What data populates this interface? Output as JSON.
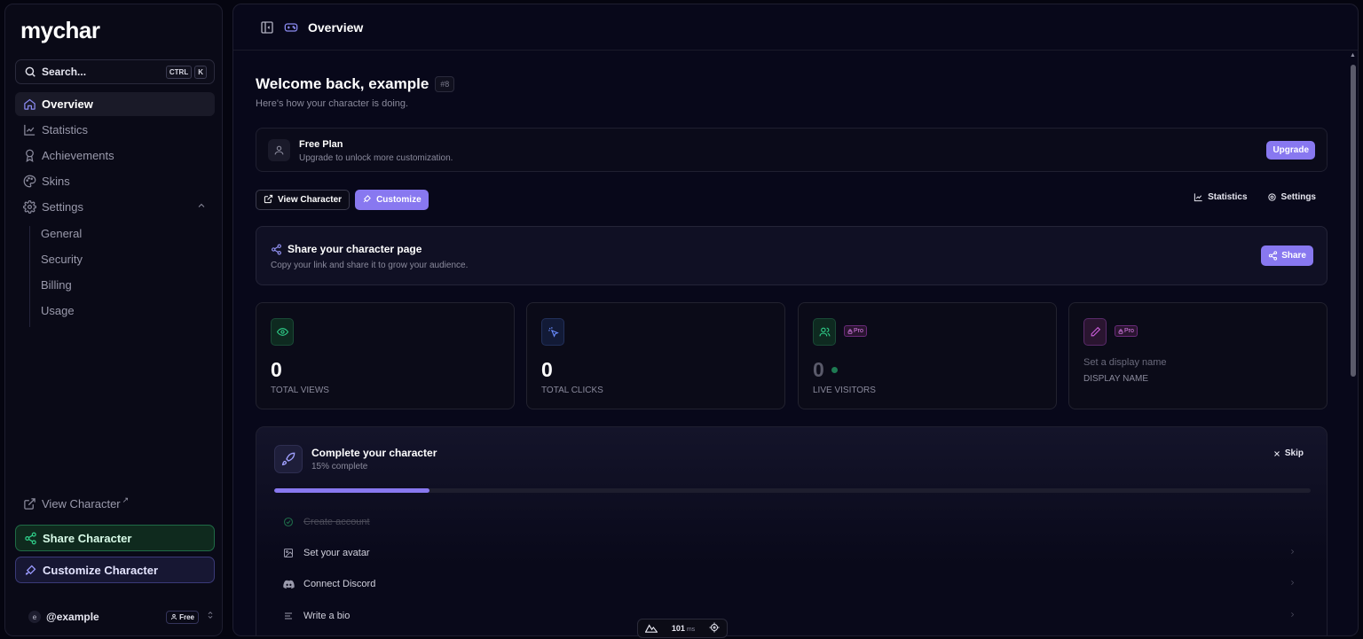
{
  "app": {
    "logo": "mychar"
  },
  "sidebar": {
    "search": {
      "label": "Search...",
      "kbd1": "CTRL",
      "kbd2": "K"
    },
    "items": [
      {
        "label": "Overview",
        "icon": "home-icon",
        "active": true
      },
      {
        "label": "Statistics",
        "icon": "chart-line-icon"
      },
      {
        "label": "Achievements",
        "icon": "award-icon"
      },
      {
        "label": "Skins",
        "icon": "palette-icon"
      },
      {
        "label": "Settings",
        "icon": "gear-icon",
        "expanded": true
      }
    ],
    "settings_sub": [
      "General",
      "Security",
      "Billing",
      "Usage"
    ],
    "view_character": "View Character",
    "share_character": "Share Character",
    "customize_character": "Customize Character",
    "user": {
      "avatar_letter": "e",
      "name": "@example",
      "plan_badge": "Free"
    }
  },
  "topbar": {
    "title": "Overview"
  },
  "welcome": {
    "title": "Welcome back, example",
    "tag": "#8",
    "subtitle": "Here's how your character is doing."
  },
  "plan": {
    "title": "Free Plan",
    "subtitle": "Upgrade to unlock more customization.",
    "upgrade_label": "Upgrade"
  },
  "actions": {
    "view_character": "View Character",
    "customize": "Customize",
    "statistics": "Statistics",
    "settings": "Settings"
  },
  "share": {
    "title": "Share your character page",
    "subtitle": "Copy your link and share it to grow your audience.",
    "button": "Share"
  },
  "stats": [
    {
      "value": "0",
      "label": "TOTAL VIEWS",
      "icon": "eye-icon",
      "color": "#2fd08a"
    },
    {
      "value": "0",
      "label": "TOTAL CLICKS",
      "icon": "cursor-click-icon",
      "color": "#6a8cff"
    },
    {
      "value": "0",
      "label": "LIVE VISITORS",
      "icon": "users-icon",
      "color": "#2fd08a",
      "pro": "Pro"
    },
    {
      "placeholder": "Set a display name",
      "label": "DISPLAY NAME",
      "icon": "pencil-icon",
      "color": "#d060e0",
      "pro": "Pro"
    }
  ],
  "onboarding": {
    "title": "Complete your character",
    "progress_text": "15% complete",
    "progress": 0.15,
    "skip_label": "Skip",
    "tasks": [
      {
        "label": "Create account",
        "done": true,
        "icon": "check-circle-icon"
      },
      {
        "label": "Set your avatar",
        "done": false,
        "icon": "image-icon"
      },
      {
        "label": "Connect Discord",
        "done": false,
        "icon": "discord-icon"
      },
      {
        "label": "Write a bio",
        "done": false,
        "icon": "text-lines-icon"
      }
    ]
  },
  "perf": {
    "value": "101",
    "unit": "ms"
  },
  "colors": {
    "accent": "#8878f0",
    "green": "#2fd08a",
    "background": "#050510"
  }
}
